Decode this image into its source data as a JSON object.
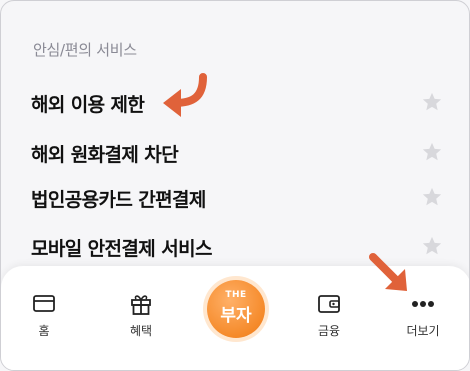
{
  "section": {
    "title": "안심/편의 서비스"
  },
  "menu_items": [
    {
      "label": "해외 이용 제한"
    },
    {
      "label": "해외 원화결제 차단"
    },
    {
      "label": "법인공용카드 간편결제"
    },
    {
      "label": "모바일 안전결제 서비스"
    }
  ],
  "bottom_nav": {
    "items": [
      {
        "label": "홈",
        "icon": "card-icon"
      },
      {
        "label": "혜택",
        "icon": "gift-icon"
      },
      {
        "label": "금융",
        "icon": "wallet-icon"
      },
      {
        "label": "더보기",
        "icon": "more-dots-icon"
      }
    ],
    "center": {
      "top_text": "THE",
      "main_text": "부자"
    }
  },
  "colors": {
    "accent_arrow": "#e0623a",
    "center_button": "#f58a2a",
    "star": "#d8d8dc",
    "section_header": "#8a8a95"
  }
}
